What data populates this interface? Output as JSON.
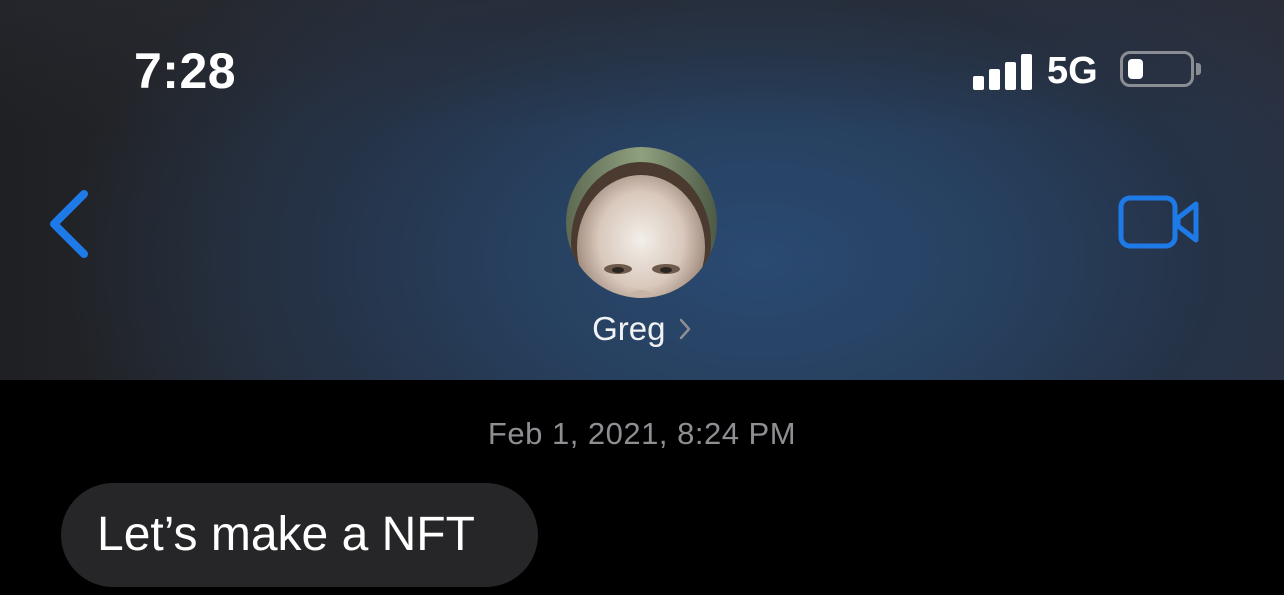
{
  "status_bar": {
    "time": "7:28",
    "network": "5G",
    "signal_bars_filled": 4,
    "battery_level_percent": 25
  },
  "nav": {
    "back_icon": "chevron-left-icon",
    "video_icon": "video-camera-icon",
    "contact": {
      "name": "Greg",
      "avatar_icon": "contact-photo"
    }
  },
  "conversation": {
    "timestamp": "Feb 1, 2021, 8:24 PM",
    "messages": [
      {
        "direction": "incoming",
        "text": "Let’s make a NFT"
      }
    ]
  },
  "colors": {
    "accent": "#1e7ae6",
    "bubble_incoming": "#262628",
    "timestamp_text": "#8e8e93",
    "background": "#000000"
  }
}
